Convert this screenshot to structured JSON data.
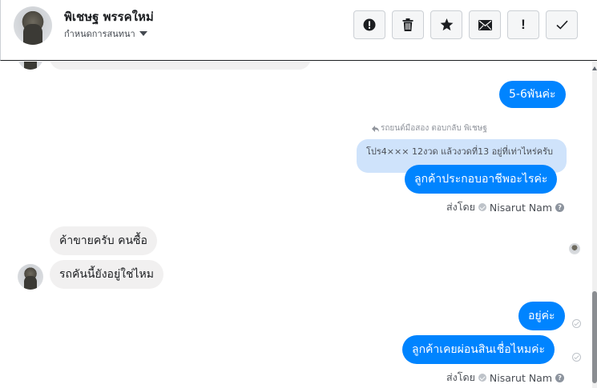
{
  "header": {
    "contact_name": "พิเชษฐ พรรคใหม่",
    "conversation_settings": "กำหนดการสนทนา"
  },
  "toolbar": {
    "buttons": [
      {
        "name": "spam",
        "icon": "alert-circle-icon"
      },
      {
        "name": "delete",
        "icon": "trash-icon"
      },
      {
        "name": "star",
        "icon": "star-icon"
      },
      {
        "name": "mark-unread",
        "icon": "envelope-icon"
      },
      {
        "name": "follow-up",
        "icon": "exclamation-icon",
        "label": "!"
      },
      {
        "name": "done",
        "icon": "checkmark-icon"
      }
    ]
  },
  "messages": {
    "out_1": "5-6พันค่ะ",
    "reply_note": "รถยนต์มือสอง ตอบกลับ พิเชษฐ",
    "quoted": "โปร4××× 12งวด แล้วงวดที่13 อยู่ที่เท่าไหร่ครับ",
    "out_2": "ลูกค้าประกอบอาชีพอะไรค่ะ",
    "sent_by_prefix_1": "ส่งโดย",
    "sent_by_name_1": "Nisarut Nam",
    "in_1": "ค้าขายครับ คนซื้อ",
    "in_2": "รถคันนี้ยังอยู่ใช่ไหม",
    "out_3": "อยู่ค่ะ",
    "out_4": "ลูกค้าเคยผ่อนสินเชื่อไหมค่ะ",
    "sent_by_prefix_2": "ส่งโดย",
    "sent_by_name_2": "Nisarut Nam"
  },
  "colors": {
    "outgoing_bubble": "#0084ff",
    "incoming_bubble": "#f1f0f0",
    "quoted_bubble": "#cfe3fb"
  }
}
